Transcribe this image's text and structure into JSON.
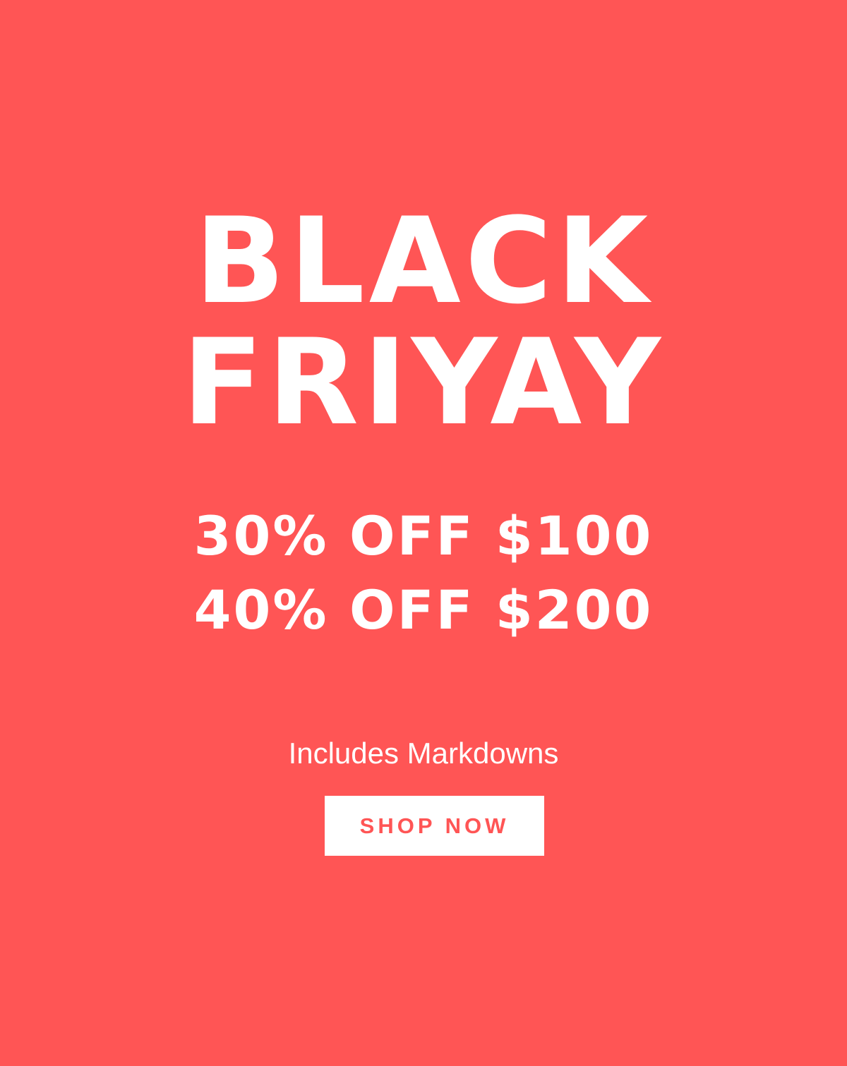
{
  "headline": {
    "line1": "BLACK",
    "line2": "FRIYAY"
  },
  "offers": [
    "30% OFF $100",
    "40% OFF $200"
  ],
  "subtext": "Includes Markdowns",
  "cta": {
    "label": "SHOP NOW"
  },
  "colors": {
    "background": "#ff5555",
    "text": "#ffffff",
    "button_background": "#ffffff",
    "button_text": "#ff5555"
  }
}
